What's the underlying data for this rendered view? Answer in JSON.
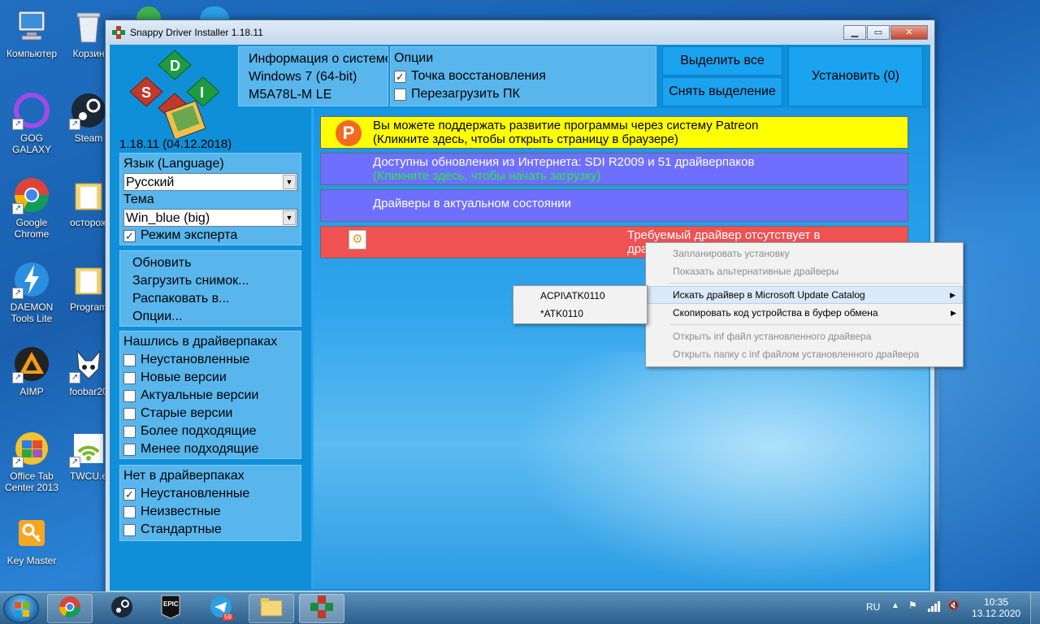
{
  "desktop": {
    "icons": [
      {
        "label": "Компьютер"
      },
      {
        "label": "Корзин"
      },
      {
        "label": "GOG GALAXY"
      },
      {
        "label": "Steam"
      },
      {
        "label": "Google Chrome"
      },
      {
        "label": "осторож"
      },
      {
        "label": "DAEMON Tools Lite"
      },
      {
        "label": "Program"
      },
      {
        "label": "AIMP"
      },
      {
        "label": "foobar20"
      },
      {
        "label": "Office Tab Center 2013"
      },
      {
        "label": "TWCU.e"
      },
      {
        "label": "Key Master"
      }
    ]
  },
  "window": {
    "title": "Snappy Driver Installer 1.18.11",
    "version": "1.18.11 (04.12.2018)",
    "logo_letters": [
      "D",
      "S",
      "I"
    ],
    "info": {
      "heading": "Информация о системе",
      "os": "Windows 7 (64-bit)",
      "board": "M5A78L-M LE"
    },
    "options": {
      "heading": "Опции",
      "restore_point": {
        "label": "Точка восстановления",
        "checked": true
      },
      "reboot": {
        "label": "Перезагрузить ПК",
        "checked": false
      }
    },
    "buttons": {
      "select_all": "Выделить все",
      "deselect": "Снять выделение",
      "install": "Установить (0)"
    },
    "language": {
      "label": "Язык (Language)",
      "value": "Русский"
    },
    "theme": {
      "label": "Тема",
      "value": "Win_blue (big)"
    },
    "expert_mode": {
      "label": "Режим эксперта",
      "checked": true
    },
    "actions": [
      "Обновить",
      "Загрузить снимок...",
      "Распаковать в...",
      "Опции..."
    ],
    "found_group": {
      "heading": "Нашлись в драйверпаках",
      "items": [
        {
          "label": "Неустановленные",
          "checked": false
        },
        {
          "label": "Новые версии",
          "checked": false
        },
        {
          "label": "Актуальные версии",
          "checked": false
        },
        {
          "label": "Старые версии",
          "checked": false
        },
        {
          "label": "Более подходящие",
          "checked": false
        },
        {
          "label": "Менее подходящие",
          "checked": false
        }
      ]
    },
    "missing_group": {
      "heading": "Нет в драйверпаках",
      "items": [
        {
          "label": "Неустановленные",
          "checked": true
        },
        {
          "label": "Неизвестные",
          "checked": false
        },
        {
          "label": "Стандартные",
          "checked": false
        }
      ]
    },
    "banners": {
      "patreon_line1": "Вы можете поддержать развитие программы через систему Patreon",
      "patreon_line2": "(Кликните здесь, чтобы открыть страницу в браузере)",
      "updates_line1": "Доступны обновления из Интернета: SDI R2009 и 51 драйверпаков",
      "updates_line2": "(Кликните здесь, чтобы начать загрузку)",
      "uptodate": "Драйверы в актуальном состоянии",
      "missing_line1": "Требуемый драйвер отсутствует в",
      "missing_line2": "драй"
    }
  },
  "context_menu": {
    "items": [
      {
        "label": "Запланировать установку",
        "disabled": true
      },
      {
        "label": "Показать альтернативные драйверы",
        "disabled": true
      },
      {
        "label": "Искать драйвер в Microsoft Update Catalog",
        "disabled": false,
        "submenu": true
      },
      {
        "label": "Скопировать код устройства в буфер обмена",
        "disabled": false,
        "submenu": true
      },
      {
        "label": "Открыть inf файл установленного драйвера",
        "disabled": true
      },
      {
        "label": "Открыть папку с inf файлом установленного драйвера",
        "disabled": true
      }
    ],
    "submenu_items": [
      "ACPI\\ATK0110",
      "*ATK0110"
    ]
  },
  "taskbar": {
    "language": "RU",
    "time": "10:35",
    "date": "13.12.2020",
    "telegram_badge": "59"
  },
  "colors": {
    "patreon_banner": "#ffff00",
    "update_banner": "#6f6fff",
    "missing_banner": "#f05252",
    "accent_button": "#1ba3f0"
  }
}
